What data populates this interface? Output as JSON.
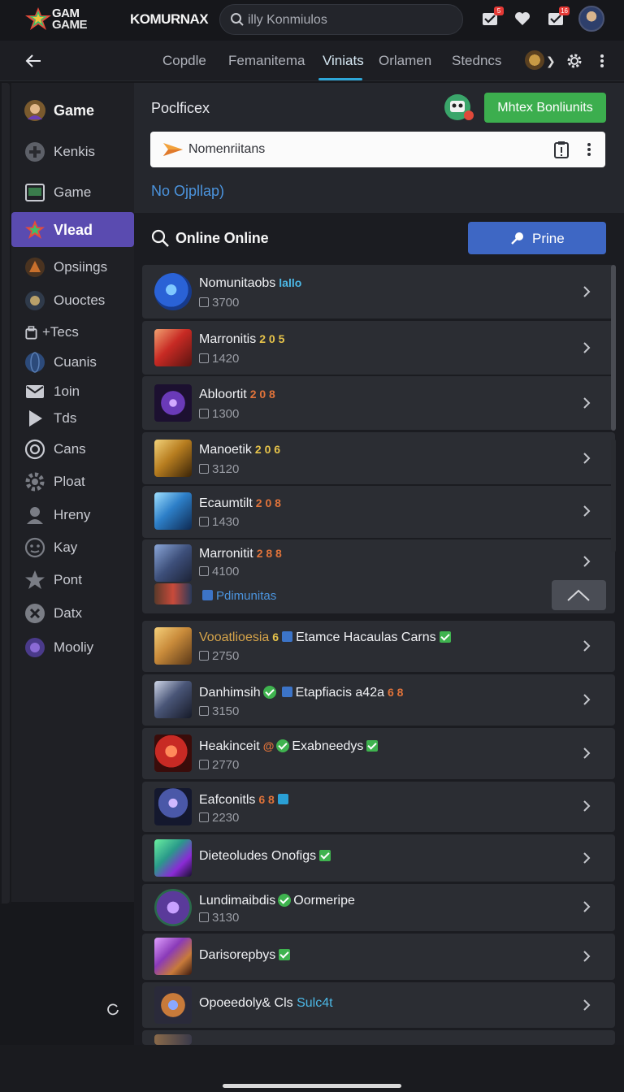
{
  "header": {
    "logo_line1": "GAM",
    "logo_line2": "GAME",
    "brand": "KOMURNAX",
    "search_value": "illy Konmiulos",
    "notif_badge_1": "5",
    "notif_badge_2": "16"
  },
  "nav": {
    "tabs": [
      {
        "label": "Copdle"
      },
      {
        "label": "Femanitema"
      },
      {
        "label": "Viniats"
      },
      {
        "label": "Orlamen"
      },
      {
        "label": "Stedncs"
      }
    ],
    "active_tab": "Viniats"
  },
  "sidebar": {
    "items": [
      {
        "label": "Game",
        "icon": "avatar-icon"
      },
      {
        "label": "Kenkis",
        "icon": "plus-circle-icon"
      },
      {
        "label": "Game",
        "icon": "terminal-icon"
      },
      {
        "label": "Vlead",
        "icon": "star-icon"
      },
      {
        "label": "Opsiings",
        "icon": "game-icon"
      },
      {
        "label": "Ouoctes",
        "icon": "game-icon"
      },
      {
        "label": "+Tecs",
        "icon": "bag-icon"
      },
      {
        "label": "Cuanis",
        "icon": "globe-icon"
      },
      {
        "label": "1oin",
        "icon": "mail-icon"
      },
      {
        "label": "Tds",
        "icon": "play-icon"
      },
      {
        "label": "Cans",
        "icon": "target-icon"
      },
      {
        "label": "Ploat",
        "icon": "gear-icon"
      },
      {
        "label": "Hreny",
        "icon": "user-icon"
      },
      {
        "label": "Kay",
        "icon": "face-icon"
      },
      {
        "label": "Pont",
        "icon": "star-icon"
      },
      {
        "label": "Datx",
        "icon": "close-circle-icon"
      },
      {
        "label": "Mooliy",
        "icon": "game-icon"
      }
    ]
  },
  "panel": {
    "title": "Poclficex",
    "green_button": "Mhtex Bonliunits",
    "select_value": "Nomenriitans",
    "link": "No Ojpllap)"
  },
  "online": {
    "title": "Online Online",
    "button": "Prine"
  },
  "list": [
    {
      "name": "Nomunitaobs",
      "tag": "lallo",
      "tag_color": "c",
      "count": "3700"
    },
    {
      "name": "Marronitis",
      "tag": "2 0 5",
      "tag_color": "y",
      "count": "1420"
    },
    {
      "name": "Abloortit",
      "tag": "2 0 8",
      "tag_color": "o",
      "count": "1300"
    },
    {
      "name": "Manoetik",
      "tag": "2 0 6",
      "tag_color": "y",
      "count": "3120"
    },
    {
      "name": "Ecaumtilt",
      "tag": "2 0 8",
      "tag_color": "o",
      "count": "1430"
    },
    {
      "name": "Marronitit",
      "tag": "2 8 8",
      "tag_color": "o",
      "count": "4100",
      "extra": "Pdimunitas"
    },
    {
      "name": "Vooatlioesia",
      "tag": "6",
      "extra": "Etamce Hacaulas Carns",
      "count": "2750"
    },
    {
      "name": "Danhimsih",
      "extra": "Etapfiacis a42a",
      "tag": "6 8",
      "tag_color": "o",
      "count": "3150"
    },
    {
      "name": "Heakinceit",
      "extra": "Exabneedys",
      "count": "2770"
    },
    {
      "name": "Eafconitls",
      "tag": "6 8",
      "tag_color": "o",
      "count": "2230"
    },
    {
      "name": "Dieteoludes Onofigs",
      "count": ""
    },
    {
      "name": "Lundimaibdis",
      "extra": "Oormeripe",
      "count": "3130"
    },
    {
      "name": "Darisorepbys",
      "count": ""
    },
    {
      "name": "Opoeedoly& Cls",
      "extra": "Sulc4t",
      "count": ""
    }
  ],
  "colors": {
    "accent_purple": "#5a4bb0",
    "accent_green": "#3cae4e",
    "accent_blue": "#3e67c4",
    "tab_underline": "#2ea7d8"
  }
}
